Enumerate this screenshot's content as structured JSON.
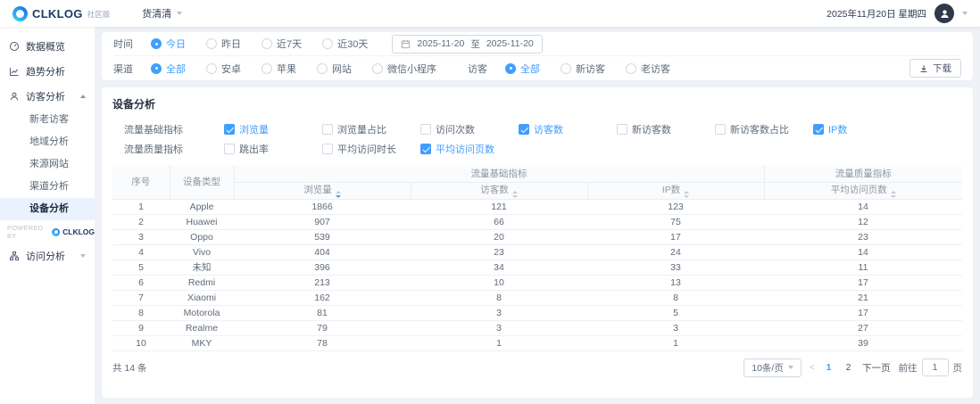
{
  "colors": {
    "primary": "#409eff"
  },
  "topbar": {
    "logo_text": "CLKLOG",
    "edition": "社区版",
    "project": "货清清",
    "date": "2025年11月20日 星期四"
  },
  "sidebar": {
    "overview": "数据概览",
    "trend": "趋势分析",
    "visitor_group": "访客分析",
    "visit_group": "访问分析",
    "sub": [
      "新老访客",
      "地域分析",
      "来源网站",
      "渠道分析",
      "设备分析"
    ],
    "powered_by": "POWERED BY",
    "powered_logo": "CLKLOG"
  },
  "filters": {
    "time_label": "时间",
    "time_options": [
      "今日",
      "昨日",
      "近7天",
      "近30天"
    ],
    "time_selected": "今日",
    "date_start": "2025-11-20",
    "date_to": "至",
    "date_end": "2025-11-20",
    "channel_label": "渠道",
    "channel_options": [
      "全部",
      "安卓",
      "苹果",
      "网站",
      "微信小程序"
    ],
    "channel_selected": "全部",
    "visitor_label": "访客",
    "visitor_options": [
      "全部",
      "新访客",
      "老访客"
    ],
    "visitor_selected": "全部",
    "download": "下载"
  },
  "panel": {
    "title": "设备分析",
    "basic_label": "流量基础指标",
    "basic_options": [
      "浏览量",
      "浏览量占比",
      "访问次数",
      "访客数",
      "新访客数",
      "新访客数占比",
      "IP数"
    ],
    "basic_checked": [
      true,
      false,
      false,
      true,
      false,
      false,
      true
    ],
    "quality_label": "流量质量指标",
    "quality_options": [
      "跳出率",
      "平均访问时长",
      "平均访问页数"
    ],
    "quality_checked": [
      false,
      false,
      true
    ]
  },
  "table": {
    "h_index": "序号",
    "h_device": "设备类型",
    "h_basic_group": "流量基础指标",
    "h_quality_group": "流量质量指标",
    "h_pv": "浏览量",
    "h_uv": "访客数",
    "h_ip": "IP数",
    "h_pages": "平均访问页数",
    "rows": [
      {
        "no": "1",
        "device": "Apple",
        "pv": "1866",
        "uv": "121",
        "ip": "123",
        "pages": "14"
      },
      {
        "no": "2",
        "device": "Huawei",
        "pv": "907",
        "uv": "66",
        "ip": "75",
        "pages": "12"
      },
      {
        "no": "3",
        "device": "Oppo",
        "pv": "539",
        "uv": "20",
        "ip": "17",
        "pages": "23"
      },
      {
        "no": "4",
        "device": "Vivo",
        "pv": "404",
        "uv": "23",
        "ip": "24",
        "pages": "14"
      },
      {
        "no": "5",
        "device": "未知",
        "pv": "396",
        "uv": "34",
        "ip": "33",
        "pages": "11"
      },
      {
        "no": "6",
        "device": "Redmi",
        "pv": "213",
        "uv": "10",
        "ip": "13",
        "pages": "17"
      },
      {
        "no": "7",
        "device": "Xiaomi",
        "pv": "162",
        "uv": "8",
        "ip": "8",
        "pages": "21"
      },
      {
        "no": "8",
        "device": "Motorola",
        "pv": "81",
        "uv": "3",
        "ip": "5",
        "pages": "17"
      },
      {
        "no": "9",
        "device": "Realme",
        "pv": "79",
        "uv": "3",
        "ip": "3",
        "pages": "27"
      },
      {
        "no": "10",
        "device": "MKY",
        "pv": "78",
        "uv": "1",
        "ip": "1",
        "pages": "39"
      }
    ]
  },
  "footer": {
    "total": "共 14 条",
    "page_size": "10条/页",
    "prev": "<",
    "page1": "1",
    "page2": "2",
    "next": "下一页",
    "goto": "前往",
    "goto_value": "1",
    "unit": "页"
  }
}
